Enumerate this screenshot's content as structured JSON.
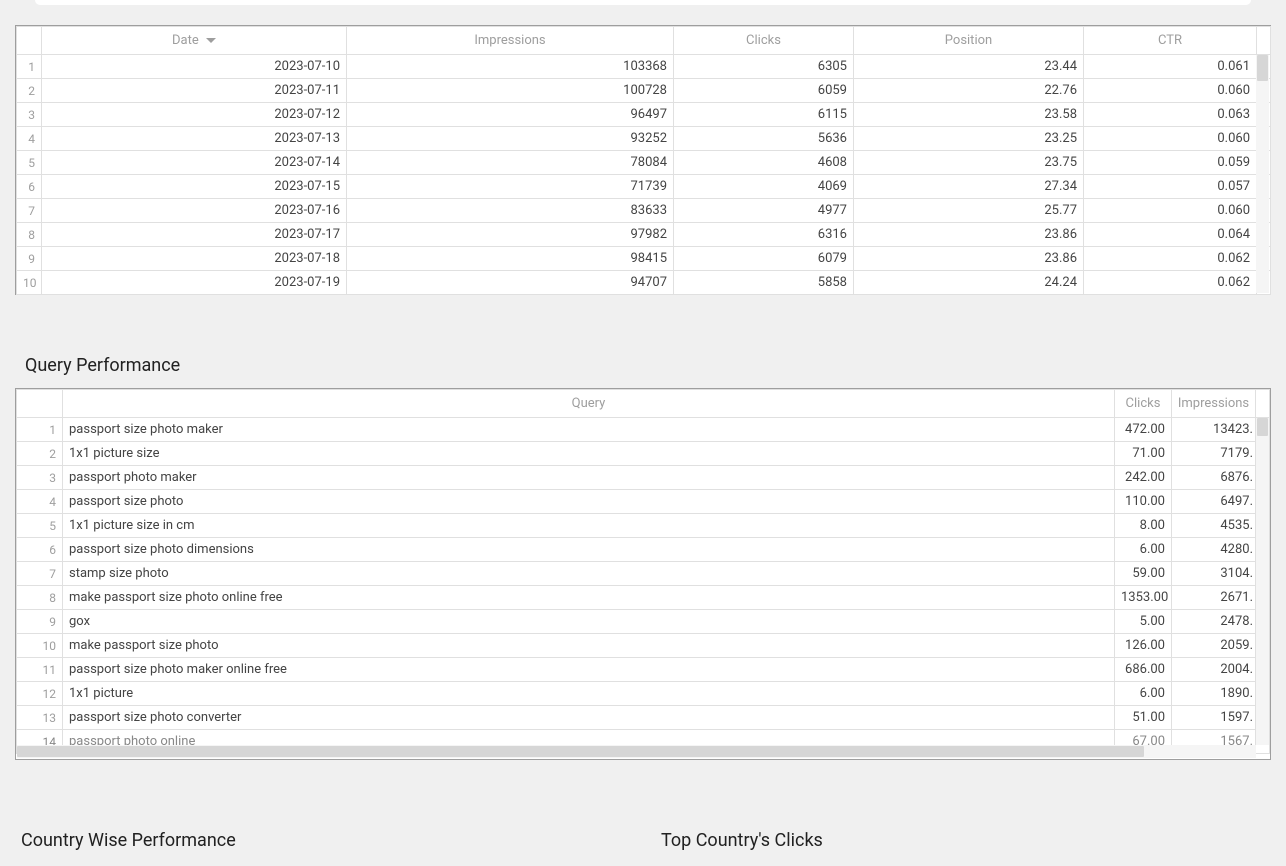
{
  "table1": {
    "columns": [
      "Date",
      "Impressions",
      "Clicks",
      "Position",
      "CTR"
    ],
    "sort_col": 0,
    "sort_dir": "desc",
    "rows": [
      [
        "2023-07-10",
        "103368",
        "6305",
        "23.44",
        "0.061"
      ],
      [
        "2023-07-11",
        "100728",
        "6059",
        "22.76",
        "0.060"
      ],
      [
        "2023-07-12",
        "96497",
        "6115",
        "23.58",
        "0.063"
      ],
      [
        "2023-07-13",
        "93252",
        "5636",
        "23.25",
        "0.060"
      ],
      [
        "2023-07-14",
        "78084",
        "4608",
        "23.75",
        "0.059"
      ],
      [
        "2023-07-15",
        "71739",
        "4069",
        "27.34",
        "0.057"
      ],
      [
        "2023-07-16",
        "83633",
        "4977",
        "25.77",
        "0.060"
      ],
      [
        "2023-07-17",
        "97982",
        "6316",
        "23.86",
        "0.064"
      ],
      [
        "2023-07-18",
        "98415",
        "6079",
        "23.86",
        "0.062"
      ],
      [
        "2023-07-19",
        "94707",
        "5858",
        "24.24",
        "0.062"
      ]
    ]
  },
  "section2_title": "Query Performance",
  "table2": {
    "columns": [
      "Query",
      "Clicks",
      "Impressions"
    ],
    "rows": [
      [
        "passport size photo maker",
        "472.00",
        "13423."
      ],
      [
        "1x1 picture size",
        "71.00",
        "7179."
      ],
      [
        "passport photo maker",
        "242.00",
        "6876."
      ],
      [
        "passport size photo",
        "110.00",
        "6497."
      ],
      [
        "1x1 picture size in cm",
        "8.00",
        "4535."
      ],
      [
        "passport size photo dimensions",
        "6.00",
        "4280."
      ],
      [
        "stamp size photo",
        "59.00",
        "3104."
      ],
      [
        "make passport size photo online free",
        "1353.00",
        "2671."
      ],
      [
        "gox",
        "5.00",
        "2478."
      ],
      [
        "make passport size photo",
        "126.00",
        "2059."
      ],
      [
        "passport size photo maker online free",
        "686.00",
        "2004."
      ],
      [
        "1x1 picture",
        "6.00",
        "1890."
      ],
      [
        "passport size photo converter",
        "51.00",
        "1597."
      ],
      [
        "passport photo online",
        "67.00",
        "1567."
      ]
    ]
  },
  "bottom_left_title": "Country Wise Performance",
  "bottom_right_title": "Top Country's Clicks"
}
